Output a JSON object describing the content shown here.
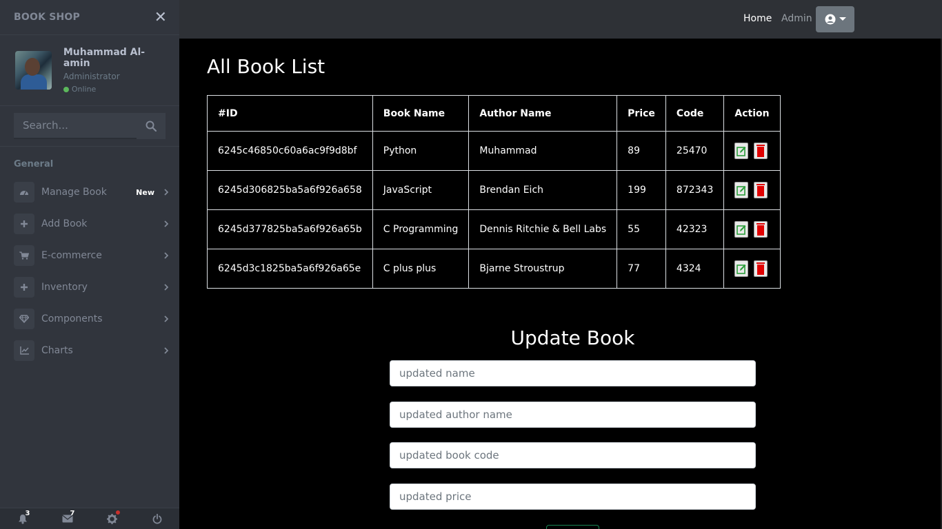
{
  "sidebar": {
    "brand": "BOOK SHOP",
    "user": {
      "name": "Muhammad Al-amin",
      "role": "Administrator",
      "status": "Online"
    },
    "search_placeholder": "Search...",
    "section_header": "General",
    "items": [
      {
        "label": "Manage Book",
        "icon": "tachometer-icon",
        "badge": "New"
      },
      {
        "label": "Add Book",
        "icon": "plus-icon"
      },
      {
        "label": "E-commerce",
        "icon": "cart-icon"
      },
      {
        "label": "Inventory",
        "icon": "plus-icon"
      },
      {
        "label": "Components",
        "icon": "diamond-icon"
      },
      {
        "label": "Charts",
        "icon": "chart-icon"
      }
    ],
    "footer": {
      "notifications": "3",
      "messages": "7"
    }
  },
  "topbar": {
    "home": "Home",
    "admin": "Admin"
  },
  "main": {
    "title": "All Book List",
    "table": {
      "headers": [
        "#ID",
        "Book Name",
        "Author Name",
        "Price",
        "Code",
        "Action"
      ],
      "rows": [
        [
          "6245c46850c60a6ac9f9d8bf",
          "Python",
          "Muhammad",
          "89",
          "25470"
        ],
        [
          "6245d306825ba5a6f926a658",
          "JavaScript",
          "Brendan Eich",
          "199",
          "872343"
        ],
        [
          "6245d377825ba5a6f926a65b",
          "C Programming",
          "Dennis Ritchie & Bell Labs",
          "55",
          "42323"
        ],
        [
          "6245d3c1825ba5a6f926a65e",
          "C plus plus",
          "Bjarne Stroustrup",
          "77",
          "4324"
        ]
      ]
    },
    "update": {
      "title": "Update Book",
      "name_placeholder": "updated name",
      "author_placeholder": "updated author name",
      "code_placeholder": "updated book code",
      "price_placeholder": "updated price"
    }
  },
  "colors": {
    "sidebar_bg": "#31353d",
    "topbar_bg": "#2e3136",
    "main_bg": "#000000",
    "online": "#5cb85c",
    "edit_icon": "#2a9d3a",
    "delete_icon": "#e00000"
  }
}
